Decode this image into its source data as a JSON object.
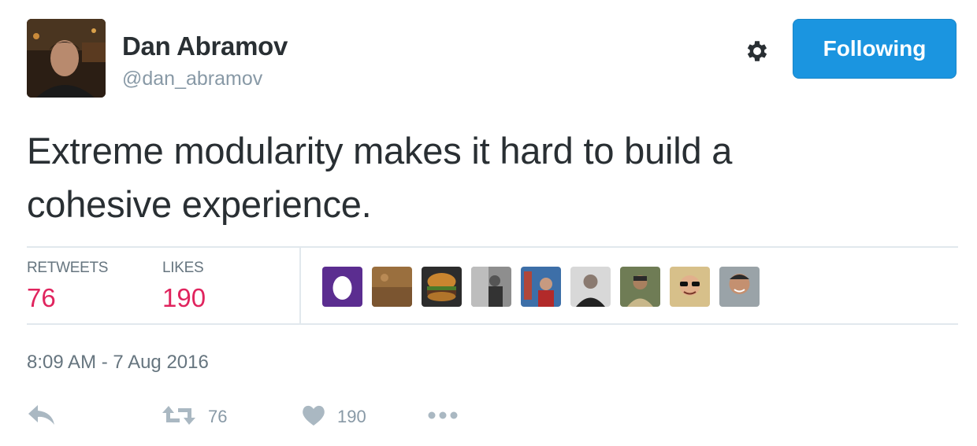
{
  "author": {
    "name": "Dan Abramov",
    "handle": "@dan_abramov",
    "avatar_icon": "profile-photo"
  },
  "header": {
    "settings_icon": "gear-icon",
    "follow_label": "Following",
    "follow_color": "#1b95e0"
  },
  "tweet": {
    "text_line1": "Extreme modularity makes it hard to build a",
    "text_line2": "cohesive experience.",
    "timestamp": "8:09 AM - 7 Aug 2016"
  },
  "stats": {
    "retweets_label": "RETWEETS",
    "retweets_value": "76",
    "likes_label": "LIKES",
    "likes_value": "190",
    "value_color": "#e0245e"
  },
  "likers": [
    {
      "name": "egg-avatar"
    },
    {
      "name": "sand-avatar"
    },
    {
      "name": "burger-avatar"
    },
    {
      "name": "person-avatar-1"
    },
    {
      "name": "person-avatar-2"
    },
    {
      "name": "person-avatar-3"
    },
    {
      "name": "person-avatar-4"
    },
    {
      "name": "sunglasses-avatar"
    },
    {
      "name": "person-avatar-5"
    }
  ],
  "actions": {
    "reply_icon": "reply-icon",
    "retweet_icon": "retweet-icon",
    "retweet_count": "76",
    "like_icon": "heart-icon",
    "like_count": "190",
    "more_icon": "more-icon"
  }
}
